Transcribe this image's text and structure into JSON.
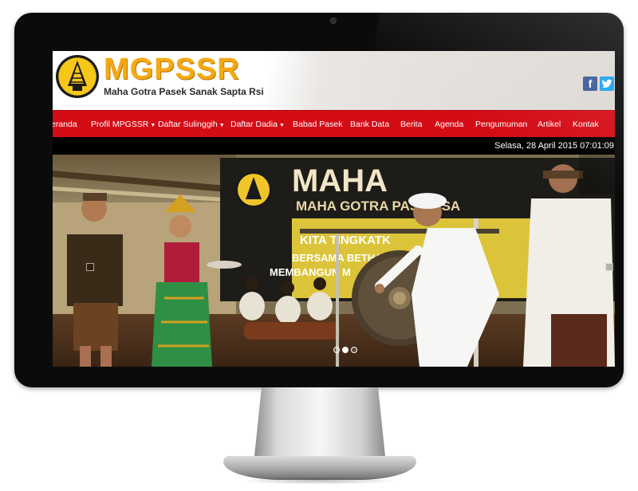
{
  "site": {
    "name": "MGPSSR",
    "tagline": "Maha Gotra Pasek Sanak Sapta Rsi",
    "social": [
      "facebook-icon",
      "twitter-icon"
    ],
    "social_labels": {
      "facebook": "f",
      "twitter": "t"
    }
  },
  "nav": {
    "items": [
      {
        "label": "eranda",
        "dropdown": false
      },
      {
        "label": "Profil MPGSSR",
        "dropdown": true
      },
      {
        "label": "Daftar Sulinggih",
        "dropdown": true
      },
      {
        "label": "Daftar Dadia",
        "dropdown": true
      },
      {
        "label": "Babad Pasek",
        "dropdown": false
      },
      {
        "label": "Bank Data",
        "dropdown": false
      },
      {
        "label": "Berita",
        "dropdown": false
      },
      {
        "label": "Agenda",
        "dropdown": false
      },
      {
        "label": "Pengumuman",
        "dropdown": false
      },
      {
        "label": "Artikel",
        "dropdown": false
      },
      {
        "label": "Kontak",
        "dropdown": false
      }
    ],
    "caret": "▼"
  },
  "datetime": "Selasa, 28 April 2015 07:01:09",
  "slider": {
    "banner_line1": "MAHA",
    "banner_line2": "MAHA GOTRA PASEK SA",
    "banner_line3": "KITA TINGKATK",
    "banner_line4": "BERSAMA BETHARA K",
    "banner_line5": "MEMBANGUN M",
    "dots": 3,
    "active_dot": 1
  },
  "colors": {
    "brand_orange": "#f5a912",
    "nav_red": "#d40c16",
    "bezel": "#0b0b0b"
  }
}
